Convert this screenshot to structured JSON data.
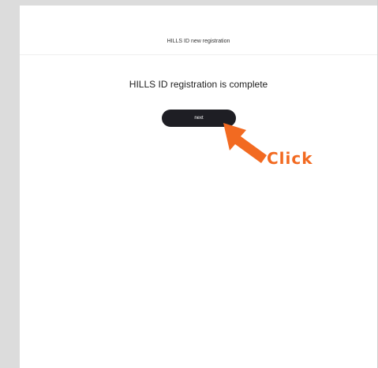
{
  "header": {
    "title": "HILLS ID new registration"
  },
  "main": {
    "message": "HILLS ID registration is complete",
    "next_label": "next"
  },
  "annotation": {
    "label": "Click",
    "color": "#f26a21"
  }
}
